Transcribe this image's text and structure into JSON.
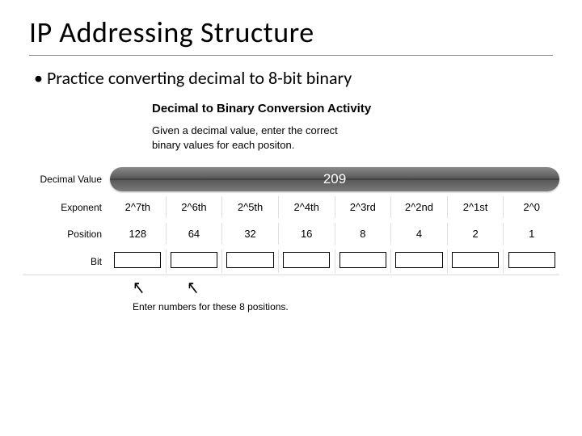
{
  "title": "IP Addressing Structure",
  "bullet_text": "Practice converting decimal to 8-bit binary",
  "activity": {
    "heading": "Decimal to Binary Conversion Activity",
    "desc_line1": "Given a decimal value, enter the correct",
    "desc_line2": "binary values for each positon."
  },
  "labels": {
    "decimal_value": "Decimal Value",
    "exponent": "Exponent",
    "position": "Position",
    "bit": "Bit"
  },
  "decimal_value": "209",
  "exponents": [
    "2^7th",
    "2^6th",
    "2^5th",
    "2^4th",
    "2^3rd",
    "2^2nd",
    "2^1st",
    "2^0"
  ],
  "positions": [
    "128",
    "64",
    "32",
    "16",
    "8",
    "4",
    "2",
    "1"
  ],
  "bits": [
    "",
    "",
    "",
    "",
    "",
    "",
    "",
    ""
  ],
  "arrow_glyph": "↖",
  "hint": "Enter numbers for these 8 positions."
}
